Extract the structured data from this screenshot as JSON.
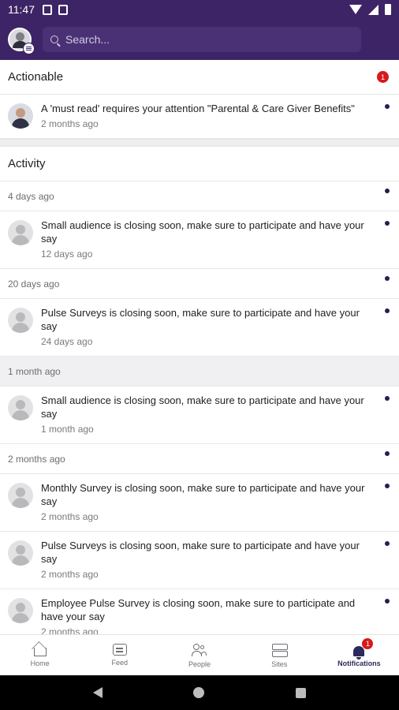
{
  "status_bar": {
    "time": "11:47"
  },
  "header": {
    "search_placeholder": "Search..."
  },
  "actionable": {
    "title": "Actionable",
    "count": "1",
    "items": [
      {
        "text": "A 'must read' requires your attention \"Parental & Care Giver Benefits\"",
        "time": "2 months ago"
      }
    ]
  },
  "activity": {
    "title": "Activity",
    "groups": [
      {
        "label": "4 days ago",
        "items": [
          {
            "text": "Small audience is closing soon, make sure to participate and have your say",
            "time": "12 days ago"
          }
        ]
      },
      {
        "label": "20 days ago",
        "items": [
          {
            "text": "Pulse Surveys is closing soon, make sure to participate and have your say",
            "time": "24 days ago"
          }
        ]
      },
      {
        "label": "1 month ago",
        "items": [
          {
            "text": "Small audience is closing soon, make sure to participate and have your say",
            "time": "1 month ago"
          }
        ]
      },
      {
        "label": "2 months ago",
        "items": [
          {
            "text": "Monthly Survey is closing soon, make sure to participate and have your say",
            "time": "2 months ago"
          },
          {
            "text": "Pulse Surveys is closing soon, make sure to participate and have your say",
            "time": "2 months ago"
          },
          {
            "text": "Employee Pulse Survey is closing soon, make sure to participate and have your say",
            "time": "2 months ago"
          }
        ]
      }
    ]
  },
  "bottom_nav": {
    "tabs": [
      {
        "label": "Home",
        "icon": "home-icon"
      },
      {
        "label": "Feed",
        "icon": "feed-icon"
      },
      {
        "label": "People",
        "icon": "people-icon"
      },
      {
        "label": "Sites",
        "icon": "sites-icon"
      },
      {
        "label": "Notifications",
        "icon": "bell-icon",
        "badge": "1",
        "active": true
      }
    ]
  },
  "colors": {
    "header_bg": "#3d2466",
    "badge": "#d61a1a",
    "unread_dot": "#22204f",
    "active_tab": "#2c2a5a"
  }
}
